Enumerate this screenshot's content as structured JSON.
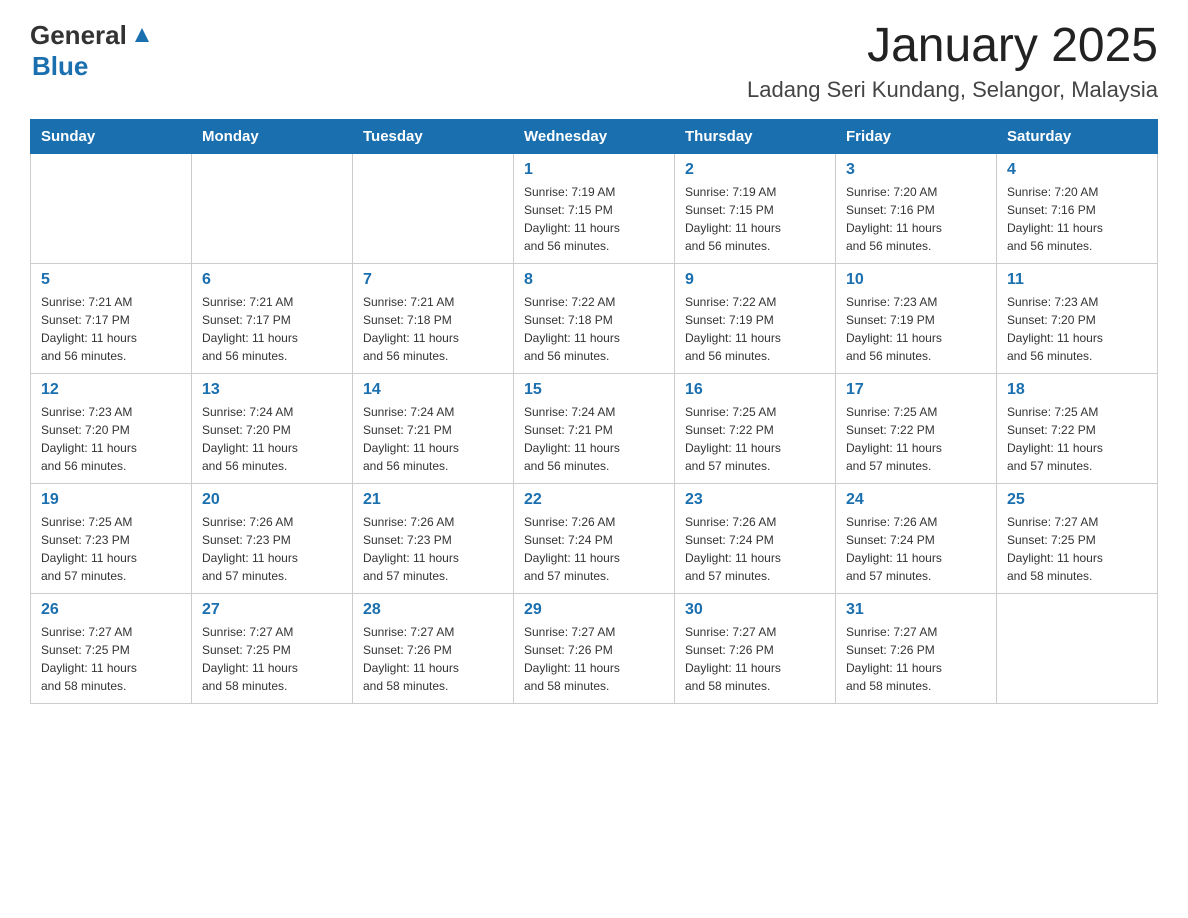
{
  "header": {
    "logo_general": "General",
    "logo_blue": "Blue",
    "month": "January 2025",
    "location": "Ladang Seri Kundang, Selangor, Malaysia"
  },
  "weekdays": [
    "Sunday",
    "Monday",
    "Tuesday",
    "Wednesday",
    "Thursday",
    "Friday",
    "Saturday"
  ],
  "weeks": [
    [
      {
        "day": "",
        "info": ""
      },
      {
        "day": "",
        "info": ""
      },
      {
        "day": "",
        "info": ""
      },
      {
        "day": "1",
        "info": "Sunrise: 7:19 AM\nSunset: 7:15 PM\nDaylight: 11 hours\nand 56 minutes."
      },
      {
        "day": "2",
        "info": "Sunrise: 7:19 AM\nSunset: 7:15 PM\nDaylight: 11 hours\nand 56 minutes."
      },
      {
        "day": "3",
        "info": "Sunrise: 7:20 AM\nSunset: 7:16 PM\nDaylight: 11 hours\nand 56 minutes."
      },
      {
        "day": "4",
        "info": "Sunrise: 7:20 AM\nSunset: 7:16 PM\nDaylight: 11 hours\nand 56 minutes."
      }
    ],
    [
      {
        "day": "5",
        "info": "Sunrise: 7:21 AM\nSunset: 7:17 PM\nDaylight: 11 hours\nand 56 minutes."
      },
      {
        "day": "6",
        "info": "Sunrise: 7:21 AM\nSunset: 7:17 PM\nDaylight: 11 hours\nand 56 minutes."
      },
      {
        "day": "7",
        "info": "Sunrise: 7:21 AM\nSunset: 7:18 PM\nDaylight: 11 hours\nand 56 minutes."
      },
      {
        "day": "8",
        "info": "Sunrise: 7:22 AM\nSunset: 7:18 PM\nDaylight: 11 hours\nand 56 minutes."
      },
      {
        "day": "9",
        "info": "Sunrise: 7:22 AM\nSunset: 7:19 PM\nDaylight: 11 hours\nand 56 minutes."
      },
      {
        "day": "10",
        "info": "Sunrise: 7:23 AM\nSunset: 7:19 PM\nDaylight: 11 hours\nand 56 minutes."
      },
      {
        "day": "11",
        "info": "Sunrise: 7:23 AM\nSunset: 7:20 PM\nDaylight: 11 hours\nand 56 minutes."
      }
    ],
    [
      {
        "day": "12",
        "info": "Sunrise: 7:23 AM\nSunset: 7:20 PM\nDaylight: 11 hours\nand 56 minutes."
      },
      {
        "day": "13",
        "info": "Sunrise: 7:24 AM\nSunset: 7:20 PM\nDaylight: 11 hours\nand 56 minutes."
      },
      {
        "day": "14",
        "info": "Sunrise: 7:24 AM\nSunset: 7:21 PM\nDaylight: 11 hours\nand 56 minutes."
      },
      {
        "day": "15",
        "info": "Sunrise: 7:24 AM\nSunset: 7:21 PM\nDaylight: 11 hours\nand 56 minutes."
      },
      {
        "day": "16",
        "info": "Sunrise: 7:25 AM\nSunset: 7:22 PM\nDaylight: 11 hours\nand 57 minutes."
      },
      {
        "day": "17",
        "info": "Sunrise: 7:25 AM\nSunset: 7:22 PM\nDaylight: 11 hours\nand 57 minutes."
      },
      {
        "day": "18",
        "info": "Sunrise: 7:25 AM\nSunset: 7:22 PM\nDaylight: 11 hours\nand 57 minutes."
      }
    ],
    [
      {
        "day": "19",
        "info": "Sunrise: 7:25 AM\nSunset: 7:23 PM\nDaylight: 11 hours\nand 57 minutes."
      },
      {
        "day": "20",
        "info": "Sunrise: 7:26 AM\nSunset: 7:23 PM\nDaylight: 11 hours\nand 57 minutes."
      },
      {
        "day": "21",
        "info": "Sunrise: 7:26 AM\nSunset: 7:23 PM\nDaylight: 11 hours\nand 57 minutes."
      },
      {
        "day": "22",
        "info": "Sunrise: 7:26 AM\nSunset: 7:24 PM\nDaylight: 11 hours\nand 57 minutes."
      },
      {
        "day": "23",
        "info": "Sunrise: 7:26 AM\nSunset: 7:24 PM\nDaylight: 11 hours\nand 57 minutes."
      },
      {
        "day": "24",
        "info": "Sunrise: 7:26 AM\nSunset: 7:24 PM\nDaylight: 11 hours\nand 57 minutes."
      },
      {
        "day": "25",
        "info": "Sunrise: 7:27 AM\nSunset: 7:25 PM\nDaylight: 11 hours\nand 58 minutes."
      }
    ],
    [
      {
        "day": "26",
        "info": "Sunrise: 7:27 AM\nSunset: 7:25 PM\nDaylight: 11 hours\nand 58 minutes."
      },
      {
        "day": "27",
        "info": "Sunrise: 7:27 AM\nSunset: 7:25 PM\nDaylight: 11 hours\nand 58 minutes."
      },
      {
        "day": "28",
        "info": "Sunrise: 7:27 AM\nSunset: 7:26 PM\nDaylight: 11 hours\nand 58 minutes."
      },
      {
        "day": "29",
        "info": "Sunrise: 7:27 AM\nSunset: 7:26 PM\nDaylight: 11 hours\nand 58 minutes."
      },
      {
        "day": "30",
        "info": "Sunrise: 7:27 AM\nSunset: 7:26 PM\nDaylight: 11 hours\nand 58 minutes."
      },
      {
        "day": "31",
        "info": "Sunrise: 7:27 AM\nSunset: 7:26 PM\nDaylight: 11 hours\nand 58 minutes."
      },
      {
        "day": "",
        "info": ""
      }
    ]
  ]
}
